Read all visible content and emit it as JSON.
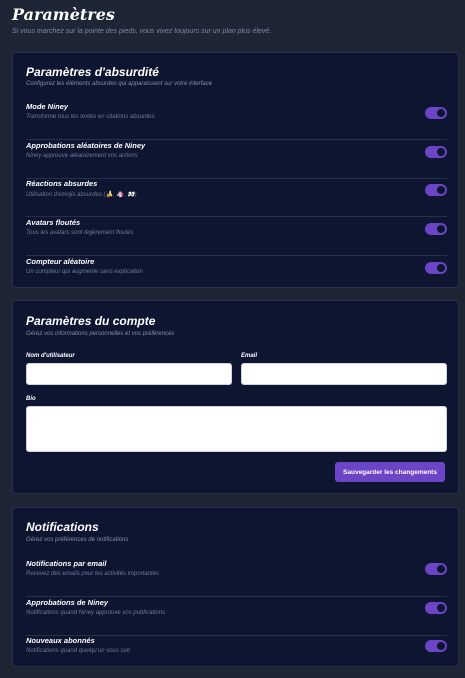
{
  "page": {
    "title": "Paramètres",
    "subtitle": "Si vous marchez sur la pointe des pieds, vous vivez toujours sur un plan plus élevé."
  },
  "absurdity": {
    "title": "Paramètres d'absurdité",
    "description": "Configurez les éléments absurdes qui apparaissent sur votre interface",
    "items": [
      {
        "label": "Mode Niney",
        "description": "Transforme tous les textes en citations absurdes",
        "enabled": true
      },
      {
        "label": "Approbations aléatoires de Niney",
        "description": "Niney approuve aléatoirement vos actions",
        "enabled": true
      },
      {
        "label": "Réactions absurdes",
        "description": "Utilisation d'emojis absurdes (🍌, 🦄, 👀)",
        "enabled": true
      },
      {
        "label": "Avatars floutés",
        "description": "Tous les avatars sont légèrement floutés",
        "enabled": true
      },
      {
        "label": "Compteur aléatoire",
        "description": "Un compteur qui augmente sans explication",
        "enabled": true
      }
    ]
  },
  "account": {
    "title": "Paramètres du compte",
    "description": "Gérez vos informations personnelles et vos préférences",
    "username_label": "Nom d'utilisateur",
    "username_placeholder": "",
    "email_label": "Email",
    "email_placeholder": "",
    "bio_label": "Bio",
    "bio_placeholder": "",
    "save_label": "Sauvegarder les changements"
  },
  "notifications": {
    "title": "Notifications",
    "description": "Gérez vos préférences de notifications",
    "items": [
      {
        "label": "Notifications par email",
        "description": "Recevez des emails pour les activités importantes",
        "enabled": true
      },
      {
        "label": "Approbations de Niney",
        "description": "Notifications quand Niney approuve vos publications",
        "enabled": true
      },
      {
        "label": "Nouveaux abonnés",
        "description": "Notifications quand quelqu'un vous suit",
        "enabled": true
      }
    ]
  },
  "colors": {
    "background": "#1e2535",
    "card": "#0d1530",
    "accent": "#6b45c6"
  }
}
